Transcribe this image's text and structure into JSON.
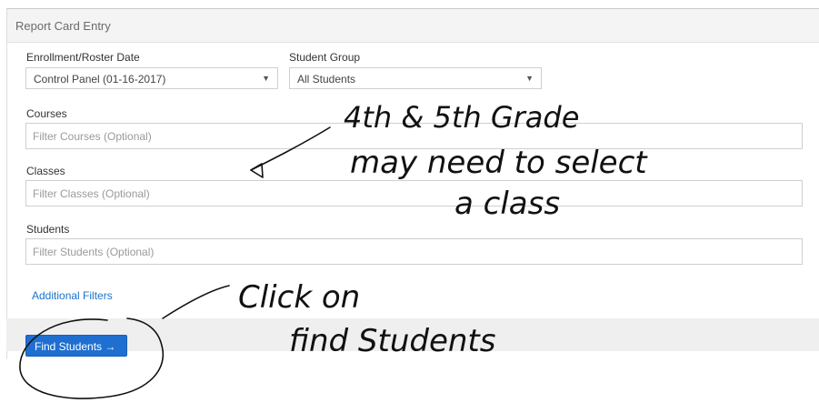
{
  "header": {
    "title": "Report Card Entry"
  },
  "form": {
    "enrollment_label": "Enrollment/Roster Date",
    "enrollment_value": "Control Panel (01-16-2017)",
    "student_group_label": "Student Group",
    "student_group_value": "All Students",
    "courses_label": "Courses",
    "courses_placeholder": "Filter Courses (Optional)",
    "classes_label": "Classes",
    "classes_placeholder": "Filter Classes (Optional)",
    "students_label": "Students",
    "students_placeholder": "Filter Students (Optional)",
    "additional_filters": "Additional Filters",
    "find_students": "Find Students →"
  },
  "annotations": {
    "note1_line1": "4th & 5th Grade",
    "note1_line2": "may need to select",
    "note1_line3": "a class",
    "note2_line1": "Click on",
    "note2_line2": "find Students"
  },
  "colors": {
    "accent": "#1f6fd1",
    "link": "#1a73c9",
    "ink": "#111111"
  }
}
